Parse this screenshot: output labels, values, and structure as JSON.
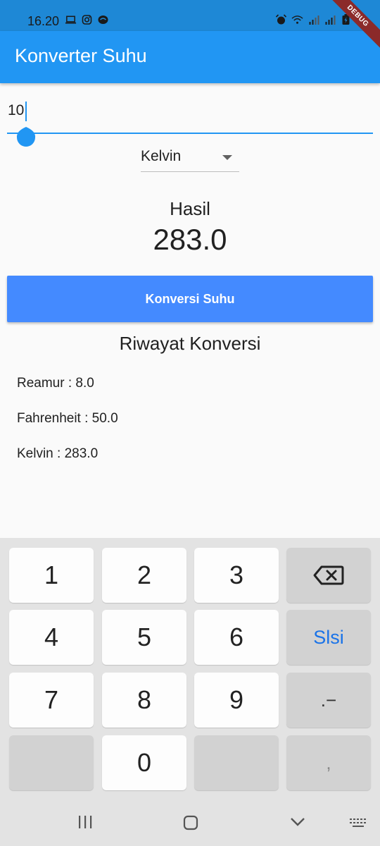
{
  "status_bar": {
    "time": "16.20",
    "debug_label": "DEBUG"
  },
  "app_bar": {
    "title": "Konverter Suhu"
  },
  "input": {
    "value": "10"
  },
  "dropdown": {
    "selected": "Kelvin"
  },
  "result": {
    "label": "Hasil",
    "value": "283.0"
  },
  "convert_button": {
    "label": "Konversi Suhu"
  },
  "history": {
    "title": "Riwayat Konversi",
    "items": [
      "Reamur : 8.0",
      "Fahrenheit : 50.0",
      "Kelvin : 283.0"
    ]
  },
  "keyboard": {
    "keys": {
      "k1": "1",
      "k2": "2",
      "k3": "3",
      "k4": "4",
      "k5": "5",
      "k6": "6",
      "k7": "7",
      "k8": "8",
      "k9": "9",
      "k0": "0",
      "next": "Slsi",
      "dot_minus": ".−",
      "comma": ","
    }
  },
  "colors": {
    "primary": "#2196f3",
    "button": "#448aff",
    "status_bar": "#1e88d6"
  }
}
